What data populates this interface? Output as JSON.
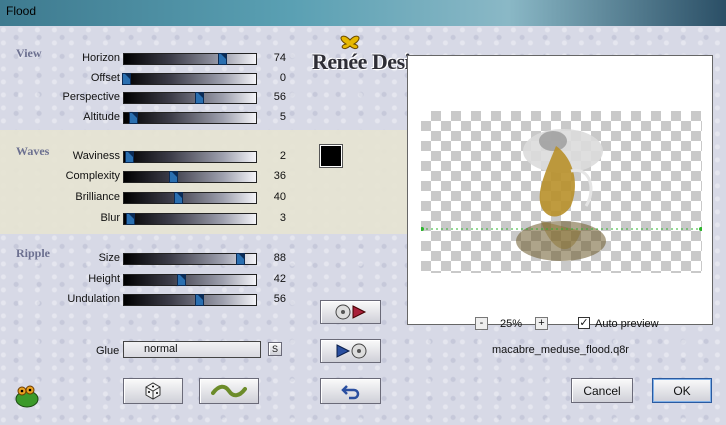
{
  "window": {
    "title": "Flood"
  },
  "logo": {
    "text": "Renée Design"
  },
  "sections": {
    "view": {
      "label": "View",
      "params": [
        {
          "label": "Horizon",
          "value": 74,
          "max": 100
        },
        {
          "label": "Offset",
          "value": 0,
          "max": 100
        },
        {
          "label": "Perspective",
          "value": 56,
          "max": 100
        },
        {
          "label": "Altitude",
          "value": 5,
          "max": 100
        }
      ]
    },
    "waves": {
      "label": "Waves",
      "params": [
        {
          "label": "Waviness",
          "value": 2,
          "max": 100
        },
        {
          "label": "Complexity",
          "value": 36,
          "max": 100
        },
        {
          "label": "Brilliance",
          "value": 40,
          "max": 100
        },
        {
          "label": "Blur",
          "value": 3,
          "max": 100
        }
      ]
    },
    "ripple": {
      "label": "Ripple",
      "params": [
        {
          "label": "Size",
          "value": 88,
          "max": 100
        },
        {
          "label": "Height",
          "value": 42,
          "max": 100
        },
        {
          "label": "Undulation",
          "value": 56,
          "max": 100
        }
      ]
    }
  },
  "glue": {
    "label": "Glue",
    "value": "normal",
    "s_label": "S"
  },
  "zoom": {
    "minus": "-",
    "value": "25%",
    "plus": "+"
  },
  "auto_preview": {
    "label": "Auto preview",
    "checked": true,
    "check": "✓"
  },
  "filename": "macabre_meduse_flood.q8r",
  "buttons": {
    "cancel": "Cancel",
    "ok": "OK"
  },
  "colors": {
    "wave_color": "#000000",
    "accent": "#2a6fb0",
    "waves_band": "#e6e4d2"
  },
  "icons": {
    "randomize": "dice-icon",
    "reset_wave": "wave-icon",
    "load_preset": "disc-arrow-right-icon",
    "save_preset": "arrow-disc-icon",
    "undo": "undo-arrow-icon",
    "app": "frog-icon"
  }
}
